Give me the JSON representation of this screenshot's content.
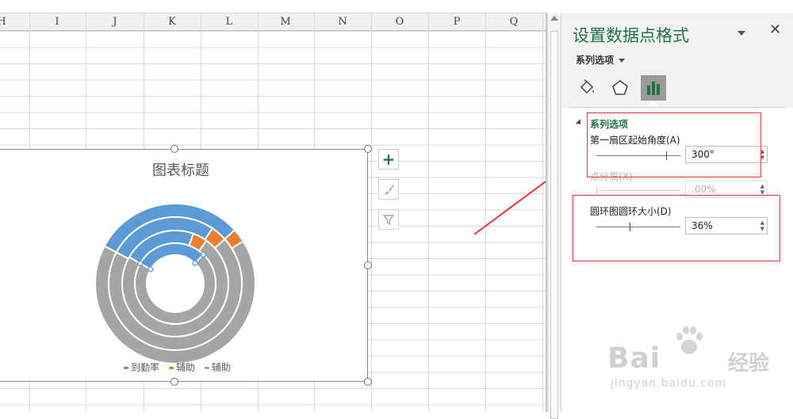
{
  "spreadsheet": {
    "columns": [
      "H",
      "I",
      "J",
      "K",
      "L",
      "M",
      "N",
      "O",
      "P",
      "Q"
    ]
  },
  "chart": {
    "title": "图表标题",
    "legend": [
      {
        "label": "到勤率",
        "color": "#5b9bd5"
      },
      {
        "label": "辅助",
        "color": "#ed7d31"
      },
      {
        "label": "辅助",
        "color": "#a5a5a5"
      }
    ],
    "colors": {
      "blue": "#5b9bd5",
      "orange": "#ed7d31",
      "gray": "#a5a5a5"
    }
  },
  "chart_buttons": {
    "add_elements": "+",
    "style": "brush-icon",
    "filter": "filter-icon"
  },
  "format_pane": {
    "title": "设置数据点格式",
    "close": "✕",
    "options_dropdown": "系列选项",
    "tabs": [
      "fill-line-icon",
      "effects-icon",
      "series-options-icon"
    ],
    "section_title": "系列选项",
    "first_slice_angle": {
      "label": "第一扇区起始角度(A)",
      "value": "300°"
    },
    "point_explosion": {
      "label": "点分离(X)",
      "value": ".00%"
    },
    "hole_size": {
      "label": "圆环图圆环大小(D)",
      "value": "36%"
    }
  },
  "watermark": {
    "brand": "Bai",
    "brand_tail": "du",
    "brand_cn": "经验",
    "url": "jingyan.baidu.com"
  }
}
